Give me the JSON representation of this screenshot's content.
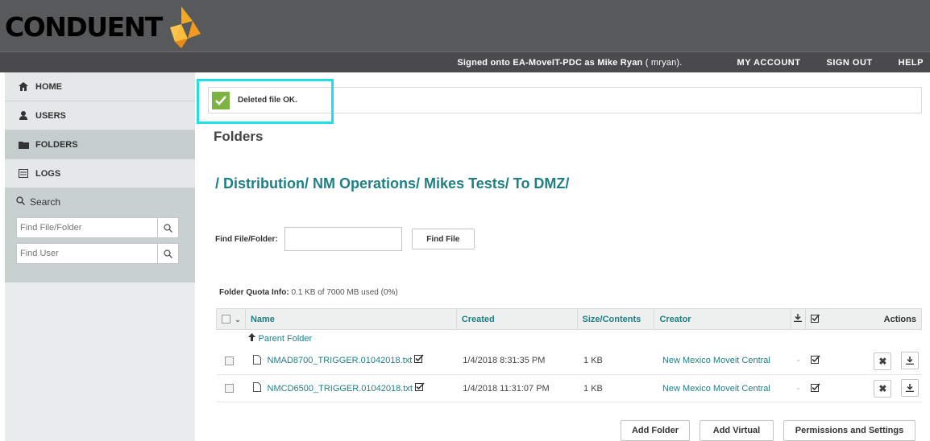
{
  "header": {
    "logo_text": "CONDUENT",
    "signed_prefix": "Signed onto ",
    "server": "EA-MoveIT-PDC",
    "signed_mid": " as ",
    "user_name": "Mike Ryan",
    "user_login": " ( mryan).",
    "nav": [
      "MY ACCOUNT",
      "SIGN OUT",
      "HELP"
    ]
  },
  "sidebar": {
    "items": [
      {
        "label": "HOME",
        "icon": "home-icon"
      },
      {
        "label": "USERS",
        "icon": "user-icon"
      },
      {
        "label": "FOLDERS",
        "icon": "folder-icon"
      },
      {
        "label": "LOGS",
        "icon": "log-icon"
      }
    ],
    "search_title": "Search",
    "file_placeholder": "Find File/Folder",
    "user_placeholder": "Find User"
  },
  "alert": {
    "text": "Deleted file OK."
  },
  "main": {
    "title": "Folders",
    "breadcrumb": [
      "/ Distribution/",
      "NM Operations/",
      "Mikes Tests/",
      "To DMZ/"
    ],
    "find_label": "Find File/Folder:",
    "find_button": "Find File",
    "quota_label": "Folder Quota Info:",
    "quota_value": "0.1 KB of 7000 MB used (0%)"
  },
  "table": {
    "headers": {
      "name": "Name",
      "created": "Created",
      "size": "Size/Contents",
      "creator": "Creator",
      "actions": "Actions"
    },
    "parent_label": "Parent Folder",
    "rows": [
      {
        "name": "NMAD8700_TRIGGER.01042018.txt",
        "created": "1/4/2018 8:31:35 PM",
        "size": "1 KB",
        "creator": "New Mexico Moveit Central",
        "dash": "-"
      },
      {
        "name": "NMCD6500_TRIGGER.01042018.txt",
        "created": "1/4/2018 11:31:07 PM",
        "size": "1 KB",
        "creator": "New Mexico Moveit Central",
        "dash": "-"
      }
    ]
  },
  "buttons": {
    "add_folder": "Add Folder",
    "add_virtual": "Add Virtual",
    "permissions": "Permissions and Settings"
  },
  "colors": {
    "accent": "#1f7f83",
    "success": "#7cb342",
    "highlight": "#1ee0e8",
    "header_bg": "#58595b"
  }
}
